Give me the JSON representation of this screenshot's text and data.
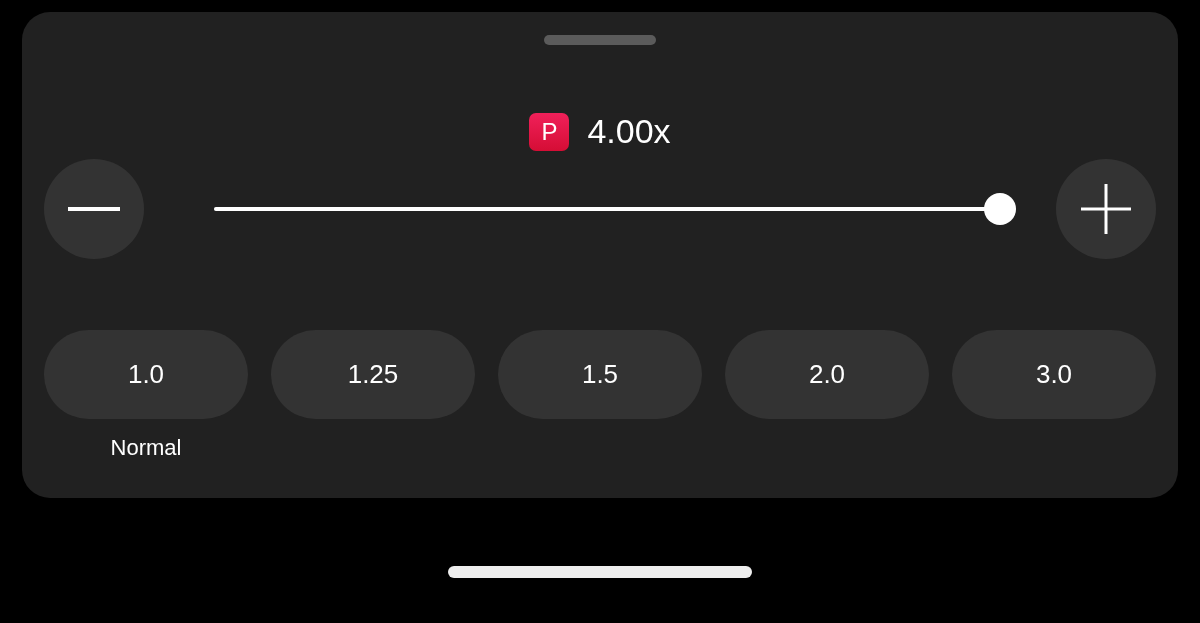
{
  "speed": {
    "badge": "P",
    "value": "4.00x"
  },
  "slider": {
    "level": 1
  },
  "presets": [
    {
      "label": "1.0",
      "caption": "Normal"
    },
    {
      "label": "1.25"
    },
    {
      "label": "1.5"
    },
    {
      "label": "2.0"
    },
    {
      "label": "3.0"
    }
  ]
}
